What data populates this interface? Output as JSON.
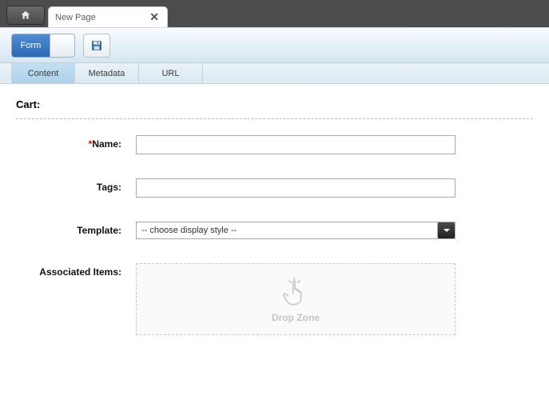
{
  "window": {
    "doc_tab_label": "New Page"
  },
  "toolbar": {
    "mode_form_label": "Form"
  },
  "subtabs": {
    "content": "Content",
    "metadata": "Metadata",
    "url": "URL"
  },
  "section": {
    "title": "Cart:"
  },
  "form": {
    "name": {
      "label": "Name:",
      "required_mark": "*",
      "value": ""
    },
    "tags": {
      "label": "Tags:",
      "value": ""
    },
    "template": {
      "label": "Template:",
      "selected": "-- choose display style --"
    },
    "associated": {
      "label": "Associated Items:",
      "dropzone_text": "Drop Zone"
    }
  }
}
